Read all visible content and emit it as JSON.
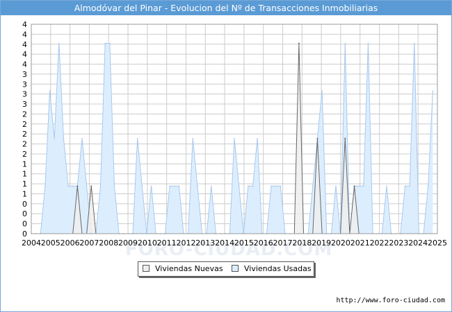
{
  "title": "Almodóvar del Pinar - Evolucion del Nº de Transacciones Inmobiliarias",
  "source": "http://www.foro-ciudad.com",
  "watermark": "FORO-CIUDAD.COM",
  "legend": {
    "nuevas_label": "Viviendas Nuevas",
    "usadas_label": "Viviendas Usadas"
  },
  "colors": {
    "title_bg": "#5b9bd5",
    "usadas_fill": "#dceefe",
    "usadas_line": "#a8c8ee",
    "nuevas_fill": "#eeeeee",
    "nuevas_line": "#666666",
    "grid": "#cccccc"
  },
  "chart_data": {
    "type": "area",
    "title": "Almodóvar del Pinar - Evolucion del Nº de Transacciones Inmobiliarias",
    "xlabel": "",
    "ylabel": "",
    "x_tick_labels": [
      "2004",
      "2005",
      "2006",
      "2007",
      "2008",
      "2009",
      "2010",
      "2011",
      "2012",
      "2013",
      "2014",
      "2015",
      "2016",
      "2017",
      "2018",
      "2019",
      "2020",
      "2021",
      "2022",
      "2023",
      "2024",
      "2025"
    ],
    "y_tick_labels": [
      "0",
      "0",
      "0",
      "0",
      "1",
      "1",
      "1",
      "1",
      "2",
      "2",
      "2",
      "2",
      "2",
      "3",
      "3",
      "3",
      "3",
      "4",
      "4",
      "4",
      "4",
      "4"
    ],
    "ylim": [
      0,
      4.4
    ],
    "grid": true,
    "legend_position": "bottom",
    "x_quarters": [
      "2004-Q1",
      "2004-Q2",
      "2004-Q3",
      "2004-Q4",
      "2005-Q1",
      "2005-Q2",
      "2005-Q3",
      "2005-Q4",
      "2006-Q1",
      "2006-Q2",
      "2006-Q3",
      "2006-Q4",
      "2007-Q1",
      "2007-Q2",
      "2007-Q3",
      "2007-Q4",
      "2008-Q1",
      "2008-Q2",
      "2008-Q3",
      "2008-Q4",
      "2009-Q1",
      "2009-Q2",
      "2009-Q3",
      "2009-Q4",
      "2010-Q1",
      "2010-Q2",
      "2010-Q3",
      "2010-Q4",
      "2011-Q1",
      "2011-Q2",
      "2011-Q3",
      "2011-Q4",
      "2012-Q1",
      "2012-Q2",
      "2012-Q3",
      "2012-Q4",
      "2013-Q1",
      "2013-Q2",
      "2013-Q3",
      "2013-Q4",
      "2014-Q1",
      "2014-Q2",
      "2014-Q3",
      "2014-Q4",
      "2015-Q1",
      "2015-Q2",
      "2015-Q3",
      "2015-Q4",
      "2016-Q1",
      "2016-Q2",
      "2016-Q3",
      "2016-Q4",
      "2017-Q1",
      "2017-Q2",
      "2017-Q3",
      "2017-Q4",
      "2018-Q1",
      "2018-Q2",
      "2018-Q3",
      "2018-Q4",
      "2019-Q1",
      "2019-Q2",
      "2019-Q3",
      "2019-Q4",
      "2020-Q1",
      "2020-Q2",
      "2020-Q3",
      "2020-Q4",
      "2021-Q1",
      "2021-Q2",
      "2021-Q3",
      "2021-Q4",
      "2022-Q1",
      "2022-Q2",
      "2022-Q3",
      "2022-Q4",
      "2023-Q1",
      "2023-Q2",
      "2023-Q3",
      "2023-Q4",
      "2024-Q1",
      "2024-Q2",
      "2024-Q3",
      "2024-Q4",
      "2025-Q1",
      "2025-Q2",
      "2025-Q3",
      "2025-Q4"
    ],
    "series": [
      {
        "name": "Viviendas Nuevas",
        "values": [
          0,
          0,
          0,
          0,
          0,
          0,
          0,
          0,
          0,
          0,
          1,
          0,
          0,
          1,
          0,
          0,
          0,
          0,
          0,
          0,
          0,
          0,
          0,
          0,
          0,
          0,
          0,
          0,
          0,
          0,
          0,
          0,
          0,
          0,
          0,
          0,
          0,
          0,
          0,
          0,
          0,
          0,
          0,
          0,
          0,
          0,
          0,
          0,
          0,
          0,
          0,
          0,
          0,
          0,
          0,
          0,
          0,
          0,
          4,
          0,
          0,
          0,
          2,
          0,
          0,
          0,
          0,
          0,
          2,
          0,
          1,
          0,
          0,
          0,
          0,
          0,
          0,
          0,
          0,
          0,
          0,
          0,
          0,
          0,
          0,
          0,
          0,
          0
        ]
      },
      {
        "name": "Viviendas Usadas",
        "values": [
          0,
          0,
          0,
          1,
          3,
          2,
          4,
          2,
          1,
          1,
          1,
          2,
          1,
          0,
          0,
          1,
          4,
          4,
          1,
          0,
          0,
          0,
          0,
          2,
          1,
          0,
          1,
          0,
          0,
          0,
          1,
          1,
          1,
          0,
          0,
          2,
          1,
          0,
          0,
          1,
          0,
          0,
          0,
          0,
          2,
          1,
          0,
          1,
          1,
          2,
          0,
          0,
          1,
          1,
          1,
          0,
          0,
          0,
          0,
          0,
          0,
          1,
          2,
          3,
          0,
          0,
          1,
          0,
          4,
          0,
          1,
          1,
          1,
          4,
          0,
          0,
          0,
          1,
          0,
          0,
          0,
          1,
          1,
          4,
          0,
          0,
          1,
          3
        ]
      }
    ]
  }
}
